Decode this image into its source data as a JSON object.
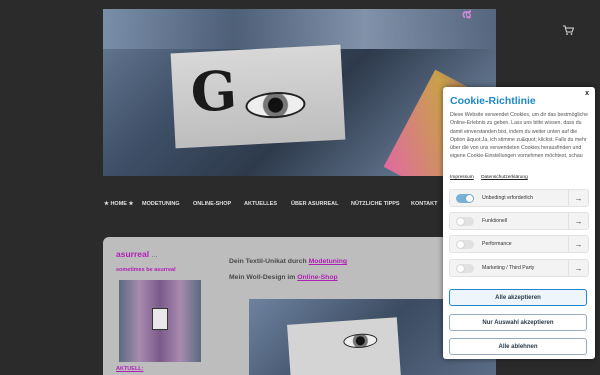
{
  "header": {
    "banner_side_text": "asurreal",
    "banner_letter": "G",
    "cart_icon": "shopping-cart-icon"
  },
  "nav": {
    "items": [
      {
        "label": "★ HOME ★"
      },
      {
        "label": "MODETUNING"
      },
      {
        "label": "ONLINE-SHOP"
      },
      {
        "label": "AKTUELLES"
      },
      {
        "label": "ÜBER ASURREAL"
      },
      {
        "label": "NÜTZLICHE TIPPS"
      },
      {
        "label": "KONTAKT"
      }
    ]
  },
  "sidebar": {
    "title": "asurreal",
    "title_dots": "...",
    "subtitle": "sometimes be asurreal",
    "aktuell": "AKTUELL:"
  },
  "main": {
    "line1_text": "Dein Textil-Unikat durch ",
    "line1_link": "Modetuning",
    "line2_text": "Mein Woll-Design im ",
    "line2_link": "Online-Shop"
  },
  "cookie": {
    "close": "x",
    "title": "Cookie-Richtlinie",
    "description": "Diese Website verwendet Cookies, um dir das bestmögliche Online-Erlebnis zu geben. Lass uns bitte wissen, dass du damit einverstanden bist, indem du weiter unten auf die Option &quot;Ja, ich stimme zu&quot; klickst. Falls du mehr über die von uns verwendeten Cookies herausfinden und eigene Cookie-Einstellungen vornehmen möchtest, schau",
    "link_impressum": "Impressum",
    "link_datenschutz": "Datenschutzerklärung",
    "options": [
      {
        "label": "Unbedingt erforderlich",
        "enabled": true
      },
      {
        "label": "Funktionell",
        "enabled": false
      },
      {
        "label": "Performance",
        "enabled": false
      },
      {
        "label": "Marketing / Third Party",
        "enabled": false
      }
    ],
    "btn_accept_all": "Alle akzeptieren",
    "btn_accept_selection": "Nur Auswahl akzeptieren",
    "btn_reject_all": "Alle ablehnen"
  },
  "colors": {
    "accent_blue": "#1e88c8",
    "magenta": "#b01fb5",
    "page_bg": "#2b2b2b",
    "content_bg": "#bdbdbd"
  }
}
